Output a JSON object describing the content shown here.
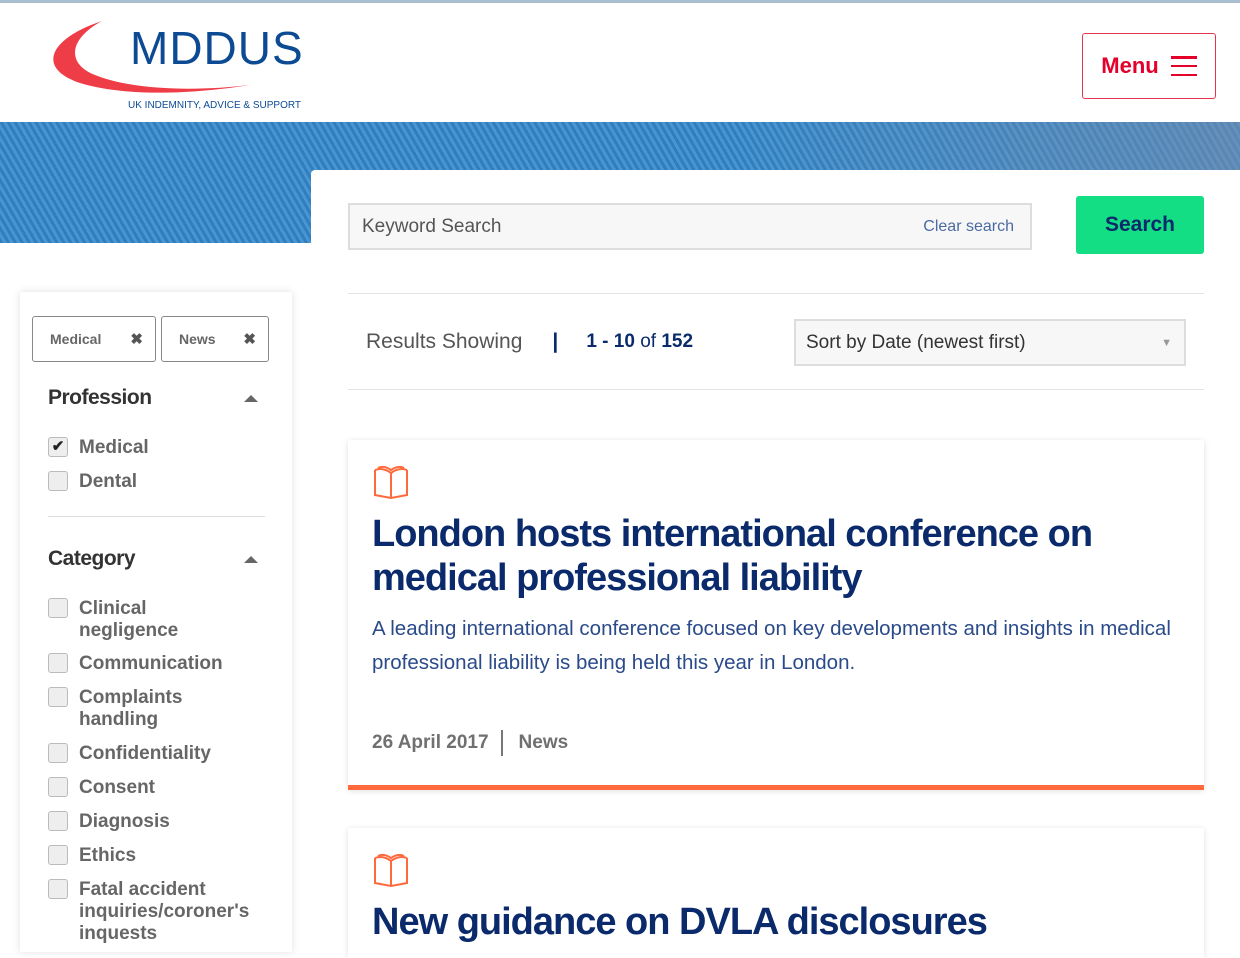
{
  "header": {
    "logo_text": "MDDUS",
    "logo_tagline": "UK INDEMNITY, ADVICE & SUPPORT",
    "menu_label": "Menu"
  },
  "search": {
    "placeholder": "Keyword Search",
    "value": "",
    "clear_label": "Clear search",
    "button_label": "Search"
  },
  "results": {
    "label": "Results Showing",
    "separator": "|",
    "range": "1 - 10",
    "of": "of",
    "total": "152"
  },
  "sort": {
    "selected": "Sort by Date (newest first)"
  },
  "filters": {
    "active_chips": [
      {
        "label": "Medical"
      },
      {
        "label": "News"
      }
    ],
    "profession": {
      "title": "Profession",
      "options": [
        {
          "label": "Medical",
          "checked": true
        },
        {
          "label": "Dental",
          "checked": false
        }
      ]
    },
    "category": {
      "title": "Category",
      "options": [
        {
          "label": "Clinical negligence",
          "checked": false
        },
        {
          "label": "Communication",
          "checked": false
        },
        {
          "label": "Complaints handling",
          "checked": false
        },
        {
          "label": "Confidentiality",
          "checked": false
        },
        {
          "label": "Consent",
          "checked": false
        },
        {
          "label": "Diagnosis",
          "checked": false
        },
        {
          "label": "Ethics",
          "checked": false
        },
        {
          "label": "Fatal accident inquiries/coroner's inquests",
          "checked": false
        }
      ]
    }
  },
  "articles": [
    {
      "icon": "book-icon",
      "title": "London hosts international conference on medical professional liability",
      "description": "A leading international conference focused on key developments and insights in medical professional liability is being held this year in London.",
      "date": "26 April 2017",
      "type": "News"
    },
    {
      "icon": "book-icon",
      "title": "New guidance on DVLA disclosures"
    }
  ],
  "colors": {
    "brand_navy": "#0a2a6b",
    "brand_red": "#e5002b",
    "search_green": "#14de84",
    "accent_orange": "#ff6a3d"
  }
}
